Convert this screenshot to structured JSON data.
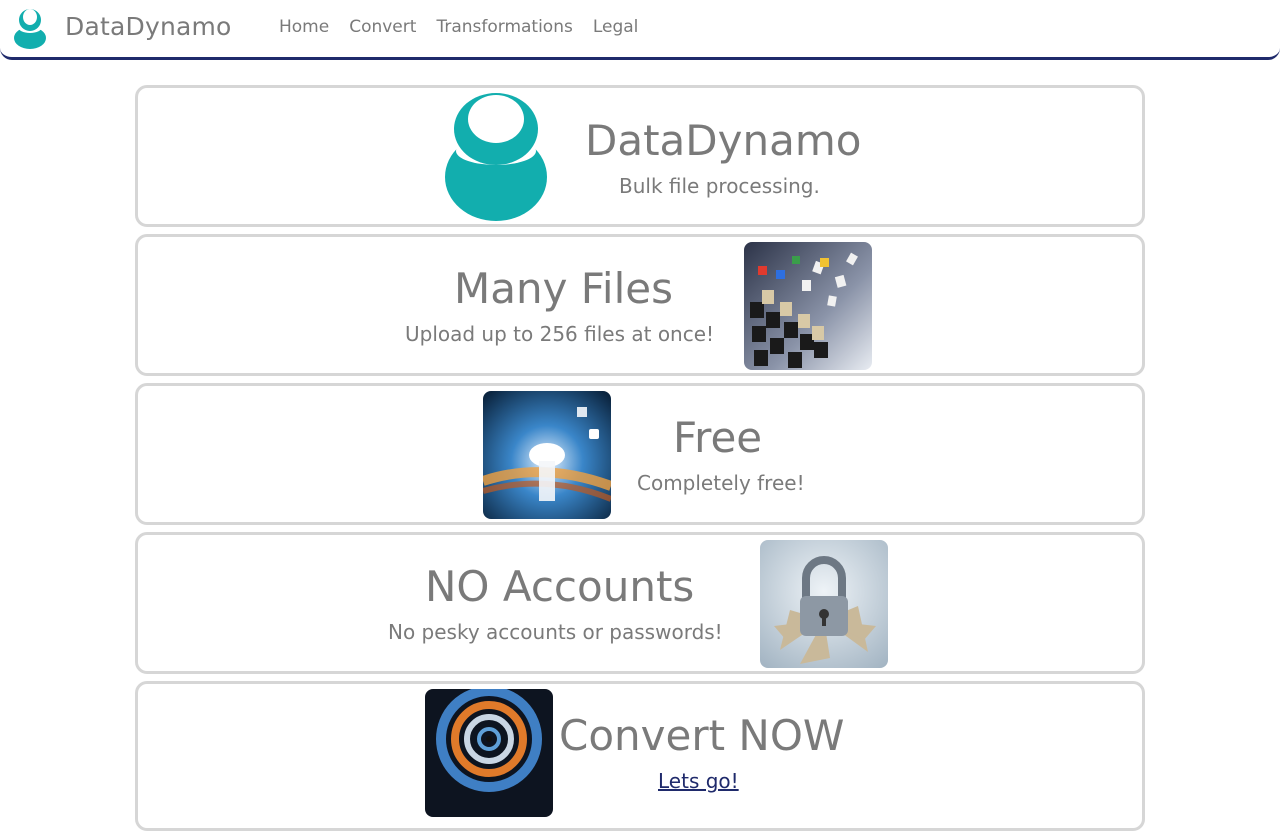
{
  "nav": {
    "brand": "DataDynamo",
    "links": [
      {
        "label": "Home"
      },
      {
        "label": "Convert"
      },
      {
        "label": "Transformations"
      },
      {
        "label": "Legal"
      }
    ]
  },
  "hero": {
    "title": "DataDynamo",
    "subtitle": "Bulk file processing."
  },
  "features": [
    {
      "title": "Many Files",
      "subtitle": "Upload up to 256 files at once!"
    },
    {
      "title": "Free",
      "subtitle": "Completely free!"
    },
    {
      "title": "NO Accounts",
      "subtitle": "No pesky accounts or passwords!"
    }
  ],
  "cta": {
    "title": "Convert NOW",
    "link_label": "Lets go!"
  },
  "colors": {
    "brand_teal": "#12aeae",
    "nav_border": "#1f2a6b",
    "text_gray": "#7a7a7a",
    "card_border": "#d6d6d6"
  },
  "icons": {
    "logo": "datadynamo-logo-icon"
  }
}
